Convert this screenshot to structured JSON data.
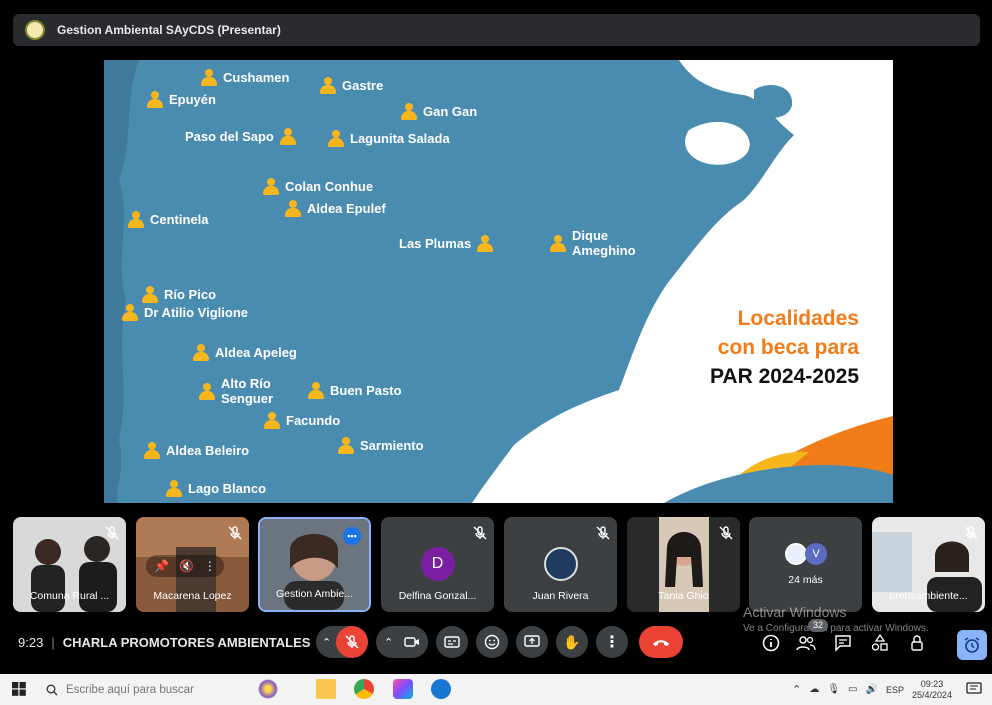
{
  "presenter": {
    "title": "Gestion Ambiental SAyCDS (Presentar)",
    "logo_icon": "org-logo"
  },
  "slide": {
    "heading_line1": "Localidades",
    "heading_line2": "con beca para",
    "heading_line3": "PAR 2024-2025",
    "colors": {
      "sea": "#4a8bb0",
      "land": "#ffffff",
      "pin": "#f6b61c",
      "accent": "#f07c1a"
    },
    "locations": [
      "Cushamen",
      "Gastre",
      "Epuyén",
      "Gan Gan",
      "Paso del Sapo",
      "Lagunita Salada",
      "Colan Conhue",
      "Aldea Epulef",
      "Centinela",
      "Las Plumas",
      "Dique",
      "Ameghino",
      "Río Pico",
      "Dr Atilio Viglione",
      "Aldea Apeleg",
      "Alto Río",
      "Senguer",
      "Buen Pasto",
      "Facundo",
      "Sarmiento",
      "Aldea Beleiro",
      "Lago Blanco"
    ]
  },
  "participants": [
    {
      "name": "Comuna Rural ...",
      "type": "video",
      "muted": true
    },
    {
      "name": "Macarena Lopez",
      "type": "video",
      "muted": true
    },
    {
      "name": "Gestion Ambie...",
      "type": "video",
      "speaking": true
    },
    {
      "name": "Delfina Gonzal...",
      "type": "avatar",
      "initial": "D",
      "color": "#7b1fa2",
      "muted": true
    },
    {
      "name": "Juan Rivera",
      "type": "photo-avatar",
      "muted": true
    },
    {
      "name": "Tania Ghio",
      "type": "video",
      "muted": true
    },
    {
      "name": "24 más",
      "type": "more",
      "initial": "V",
      "color": "#5c6bc0"
    },
    {
      "name": "prensambiente...",
      "type": "video",
      "muted": true
    }
  ],
  "controls": {
    "time": "9:23",
    "meeting_name": "CHARLA PROMOTORES AMBIENTALES",
    "people_count": "32",
    "watermark_line1": "Activar Windows",
    "watermark_line2": "Ve a Configuración para activar Windows."
  },
  "taskbar": {
    "search_placeholder": "Escribe aquí para buscar",
    "language": "ESP",
    "time": "09:23",
    "date": "25/4/2024"
  }
}
